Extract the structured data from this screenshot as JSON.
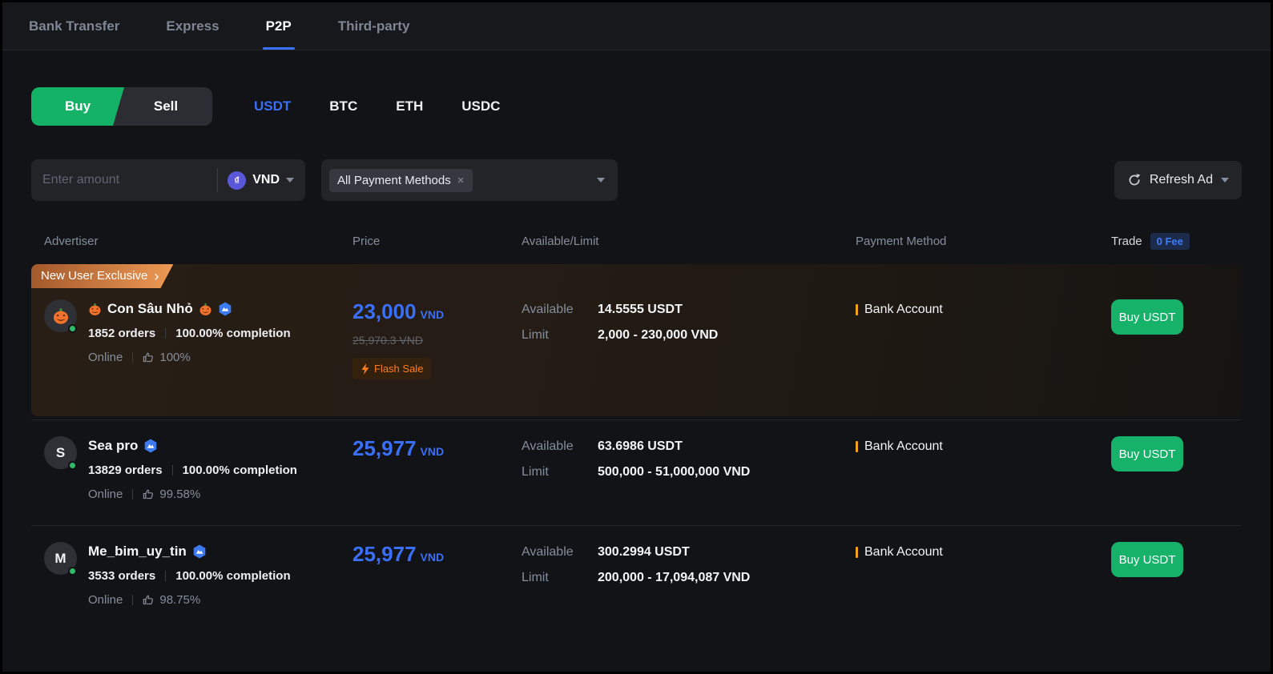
{
  "nav": {
    "tabs": [
      {
        "label": "Bank Transfer",
        "active": false
      },
      {
        "label": "Express",
        "active": false
      },
      {
        "label": "P2P",
        "active": true
      },
      {
        "label": "Third-party",
        "active": false
      }
    ]
  },
  "side_toggle": {
    "buy": "Buy",
    "sell": "Sell"
  },
  "coins": [
    {
      "label": "USDT",
      "active": true
    },
    {
      "label": "BTC",
      "active": false
    },
    {
      "label": "ETH",
      "active": false
    },
    {
      "label": "USDC",
      "active": false
    }
  ],
  "filters": {
    "amount_placeholder": "Enter amount",
    "currency": "VND",
    "currency_symbol": "₫",
    "payment_filter": "All Payment Methods",
    "payment_filter_remove": "×",
    "refresh_label": "Refresh Ad"
  },
  "table_headers": {
    "advertiser": "Advertiser",
    "price": "Price",
    "available_limit": "Available/Limit",
    "payment_method": "Payment Method",
    "trade": "Trade",
    "fee_badge": "0 Fee"
  },
  "labels": {
    "available": "Available",
    "limit": "Limit"
  },
  "rows": [
    {
      "promo": "New User Exclusive",
      "promo_chevron": "›",
      "avatar": "",
      "name": "Con Sâu Nhỏ",
      "orders": "1852 orders",
      "completion": "100.00% completion",
      "status": "Online",
      "rating": "100%",
      "price": "23,000",
      "price_unit": "VND",
      "price_old": "25,970.3 VND",
      "flash_sale": "Flash Sale",
      "available": "14.5555 USDT",
      "limit": "2,000 - 230,000 VND",
      "payment": "Bank Account",
      "action": "Buy USDT"
    },
    {
      "avatar": "S",
      "name": "Sea pro",
      "orders": "13829 orders",
      "completion": "100.00% completion",
      "status": "Online",
      "rating": "99.58%",
      "price": "25,977",
      "price_unit": "VND",
      "available": "63.6986 USDT",
      "limit": "500,000 - 51,000,000 VND",
      "payment": "Bank Account",
      "action": "Buy USDT"
    },
    {
      "avatar": "M",
      "name": "Me_bim_uy_tin",
      "orders": "3533 orders",
      "completion": "100.00% completion",
      "status": "Online",
      "rating": "98.75%",
      "price": "25,977",
      "price_unit": "VND",
      "available": "300.2994 USDT",
      "limit": "200,000 - 17,094,087 VND",
      "payment": "Bank Account",
      "action": "Buy USDT"
    }
  ],
  "colors": {
    "accent_blue": "#3a6ff7",
    "buy_green": "#14b266",
    "button_green": "#17b26a",
    "flash_orange": "#ff7d1f",
    "promo_gradient_start": "#a3592b",
    "promo_gradient_end": "#ee9a55",
    "payment_bar_amber": "#f0a218",
    "online_dot_green": "#2ebd65",
    "fee_badge_blue": "#3f7cff"
  }
}
